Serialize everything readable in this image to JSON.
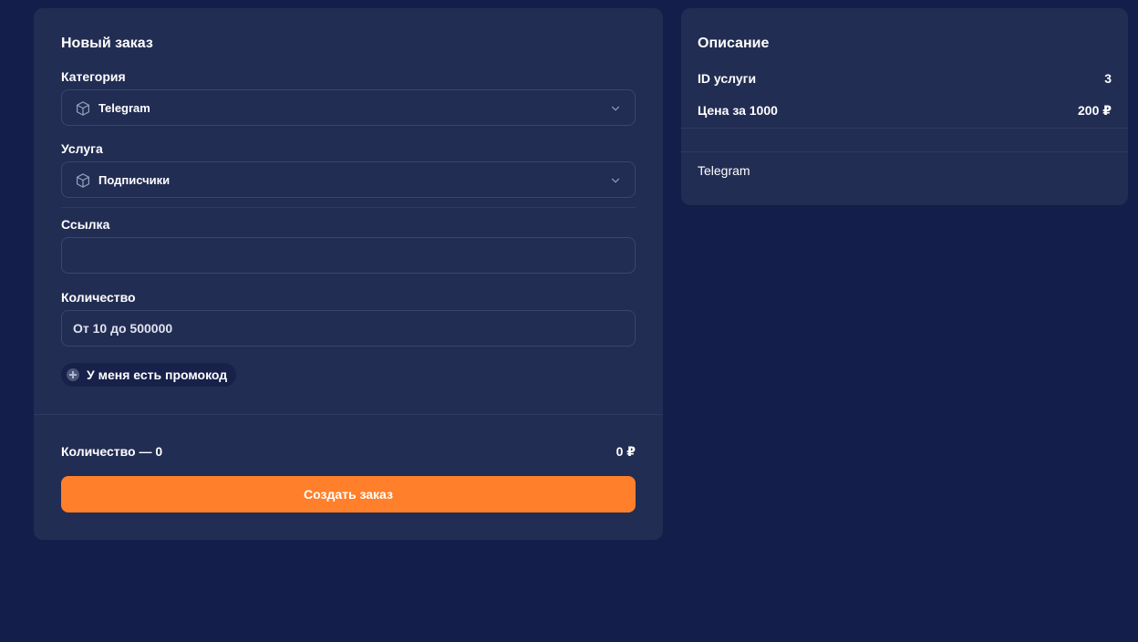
{
  "order": {
    "title": "Новый заказ",
    "category_label": "Категория",
    "category_value": "Telegram",
    "service_label": "Услуга",
    "service_value": "Подписчики",
    "link_label": "Ссылка",
    "link_value": "",
    "link_placeholder": "",
    "quantity_label": "Количество",
    "quantity_value": "",
    "quantity_placeholder": "От 10 до 500000",
    "promo_label": "У меня есть промокод",
    "summary_label": "Количество — 0",
    "summary_total": "0 ₽",
    "create_button": "Создать заказ"
  },
  "description": {
    "title": "Описание",
    "service_id_label": "ID услуги",
    "service_id_value": "3",
    "price_label": "Цена за 1000",
    "price_value": "200 ₽",
    "text": "Telegram"
  },
  "icons": {
    "category": "cube-icon",
    "service": "cube-icon",
    "dropdown": "chevron-down-icon",
    "promo": "plus-circle-icon"
  },
  "colors": {
    "page_background": "#131f4a",
    "card_background": "#222d53",
    "accent": "#ff7f2a"
  }
}
